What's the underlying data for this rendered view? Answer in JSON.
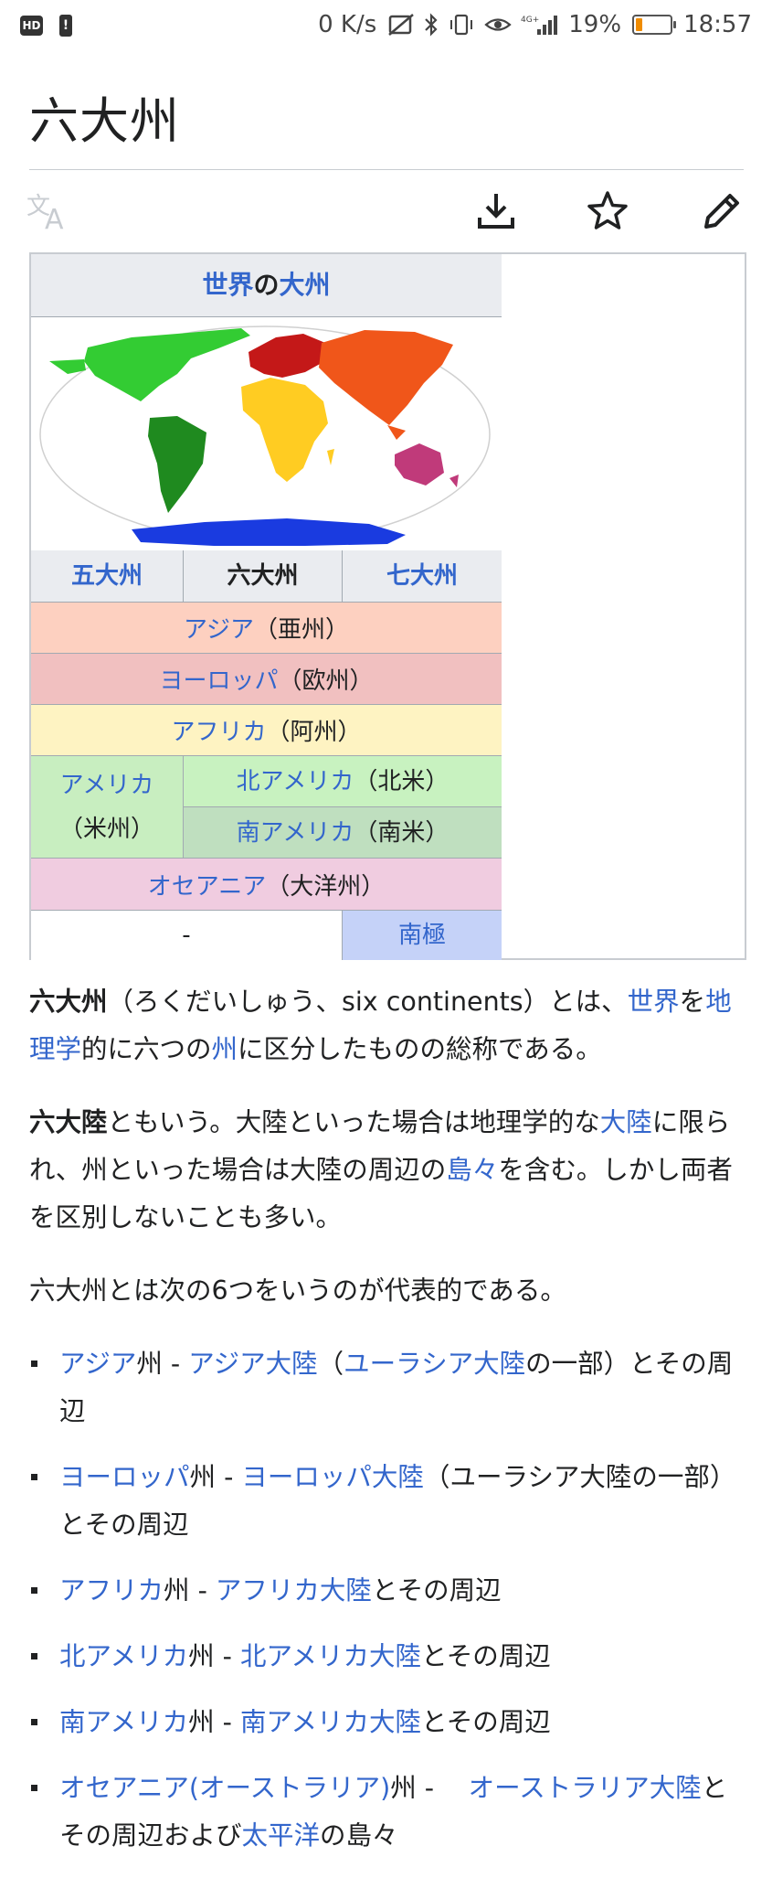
{
  "status_bar": {
    "hd_badge": "HD",
    "alert_badge": "!",
    "net_speed": "0 K/s",
    "battery_percent": "19%",
    "battery_level": 0.19,
    "time": "18:57",
    "icons": [
      "hd-icon",
      "alert-icon",
      "no-sim-icon",
      "bluetooth-icon",
      "vibrate-icon",
      "eye-comfort-icon",
      "signal-4g-icon",
      "battery-icon"
    ]
  },
  "page": {
    "title": "六大州"
  },
  "toolbar": {
    "icons": [
      "translate-icon",
      "download-icon",
      "star-icon",
      "edit-pencil-icon"
    ]
  },
  "infobox": {
    "title_part1": "世界",
    "title_part2": "の",
    "title_part3": "大州",
    "tabs": [
      "五大州",
      "六大州",
      "七大州"
    ],
    "rows": {
      "asia": {
        "link": "アジア",
        "suffix": "（亜州）",
        "color": "#fdd0c0"
      },
      "europe": {
        "link": "ヨーロッパ",
        "suffix": "（欧州）",
        "color": "#f1c0c0"
      },
      "africa": {
        "link": "アフリカ",
        "suffix": "（阿州）",
        "color": "#fef3c2"
      },
      "america": {
        "link": "アメリカ",
        "suffix": "（米州）",
        "color": "#c8eec0"
      },
      "north_america": {
        "link": "北アメリカ",
        "suffix": "（北米）",
        "color": "#c8f2c0"
      },
      "south_america": {
        "link": "南アメリカ",
        "suffix": "（南米）",
        "color": "#bfdfbf"
      },
      "oceania": {
        "link": "オセアニア",
        "suffix": "（大洋州）",
        "color": "#f0cce0"
      },
      "empty_cell": "-",
      "antarctica": {
        "link": "南極",
        "color": "#c5d2f8"
      }
    }
  },
  "article": {
    "p1": {
      "bold": "六大州",
      "t1": "（ろくだいしゅう、six continents）とは、",
      "l1": "世界",
      "t2": "を",
      "l2": "地理学",
      "t3": "的に六つの",
      "l3": "州",
      "t4": "に区分したものの総称である。"
    },
    "p2": {
      "bold": "六大陸",
      "t1": "ともいう。大陸といった場合は地理学的な",
      "l1": "大陸",
      "t2": "に限られ、州といった場合は大陸の周辺の",
      "l2": "島々",
      "t3": "を含む。しかし両者を区別しないことも多い。"
    },
    "p3": "六大州とは次の6つをいうのが代表的である。",
    "list": [
      {
        "l1": "アジア",
        "t1": "州 - ",
        "l2": "アジア大陸",
        "t2": "（",
        "l3": "ユーラシア大陸",
        "t3": "の一部）とその周辺"
      },
      {
        "l1": "ヨーロッパ",
        "t1": "州 - ",
        "l2": "ヨーロッパ大陸",
        "t2": "（ユーラシア大陸の一部）とその周辺"
      },
      {
        "l1": "アフリカ",
        "t1": "州 - ",
        "l2": "アフリカ大陸",
        "t2": "とその周辺"
      },
      {
        "l1": "北アメリカ",
        "t1": "州 - ",
        "l2": "北アメリカ大陸",
        "t2": "とその周辺"
      },
      {
        "l1": "南アメリカ",
        "t1": "州 - ",
        "l2": "南アメリカ大陸",
        "t2": "とその周辺"
      },
      {
        "l1": "オセアニア(オーストラリア)",
        "t1": "州 - 　",
        "l2": "オーストラリア大陸",
        "t2": "とその周辺および",
        "l3": "太平洋",
        "t3": "の島々"
      }
    ]
  }
}
